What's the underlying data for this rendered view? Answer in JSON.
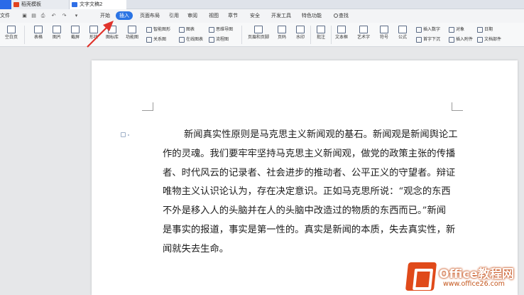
{
  "doc_tabs": [
    {
      "label": ""
    },
    {
      "label": "稻壳模板"
    },
    {
      "label": "文字文稿2"
    }
  ],
  "menubar": {
    "file_label": "文件",
    "quick_access_icons": [
      "save-icon",
      "print-preview-icon",
      "print-icon",
      "undo-icon",
      "redo-icon",
      "more-icon"
    ],
    "tabs": [
      "开始",
      "插入",
      "页面布局",
      "引用",
      "审阅",
      "视图",
      "章节",
      "安全",
      "开发工具",
      "特色功能"
    ],
    "active_tab": "插入",
    "search_label": "查找"
  },
  "ribbon": {
    "big_buttons": [
      "空白页",
      "表格",
      "图片",
      "截屏",
      "形状",
      "图标库",
      "功能图",
      "页眉和页脚",
      "页码",
      "水印",
      "批注",
      "文本框",
      "艺术字",
      "符号",
      "公式",
      "域",
      "超链接"
    ],
    "small_buttons": [
      "智能图形",
      "图表",
      "思维导图",
      "关系图",
      "在线图表",
      "流程图",
      "插入数字",
      "对象",
      "日期",
      "首字下沉",
      "插入附件",
      "文档部件"
    ]
  },
  "document": {
    "lines": [
      "新闻真实性原则是马克思主义新闻观的基石。新闻观是新闻舆论工",
      "作的灵魂。我们要牢牢坚持马克思主义新闻观，做党的政策主张的传播",
      "者、时代风云的记录者、社会进步的推动者、公平正义的守望者。辩证",
      "唯物主义认识论认为，存在决定意识。正如马克思所说：“观念的东西",
      "不外是移入人的头脑并在人的头脑中改造过的物质的东西而已。”新闻",
      "是事实的报道，事实是第一性的。真实是新闻的本质，失去真实性，新",
      "闻就失去生命。"
    ]
  },
  "annotation": {
    "color": "#e0332b"
  },
  "watermark": {
    "title": "Office教程网",
    "url": "www.office26.com",
    "brand_color": "#e04a1a"
  },
  "colors": {
    "accent": "#2b74e4"
  }
}
